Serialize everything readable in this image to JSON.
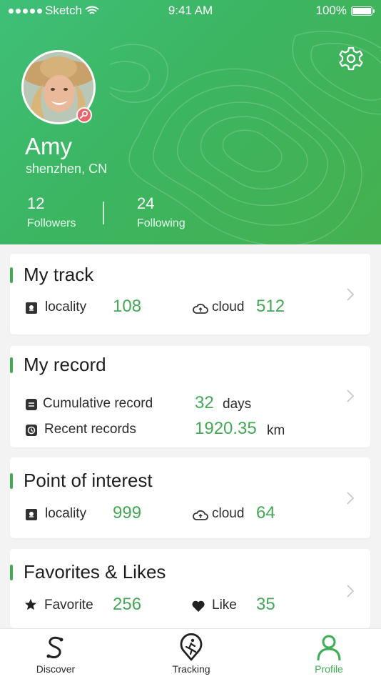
{
  "status_bar": {
    "carrier": "Sketch",
    "time": "9:41 AM",
    "battery": "100%"
  },
  "profile": {
    "name": "Amy",
    "location": "shenzhen, CN",
    "followers_count": "12",
    "followers_label": "Followers",
    "following_count": "24",
    "following_label": "Following"
  },
  "cards": {
    "my_track": {
      "title": "My track",
      "locality_label": "locality",
      "locality_value": "108",
      "cloud_label": "cloud",
      "cloud_value": "512"
    },
    "my_record": {
      "title": "My record",
      "cumulative_label": "Cumulative record",
      "cumulative_value": "32",
      "cumulative_unit": "days",
      "recent_label": "Recent records",
      "recent_value": "1920.35",
      "recent_unit": "km"
    },
    "poi": {
      "title": "Point of interest",
      "locality_label": "locality",
      "locality_value": "999",
      "cloud_label": "cloud",
      "cloud_value": "64"
    },
    "favorites": {
      "title": "Favorites & Likes",
      "favorite_label": "Favorite",
      "favorite_value": "256",
      "like_label": "Like",
      "like_value": "35"
    }
  },
  "tabbar": {
    "discover": "Discover",
    "tracking": "Tracking",
    "profile": "Profile",
    "active": "profile",
    "accent": "#3cae55"
  },
  "colors": {
    "brand_green": "#44a856",
    "header_start": "#3fbf78",
    "header_end": "#45b04f",
    "badge": "#f06269"
  },
  "icons": [
    "gear-icon",
    "wifi-icon",
    "battery-icon",
    "chevron-right-icon",
    "map-pin-icon",
    "cloud-icon",
    "list-icon",
    "clock-icon",
    "star-icon",
    "heart-icon",
    "discover-icon",
    "tracking-icon",
    "profile-icon"
  ]
}
